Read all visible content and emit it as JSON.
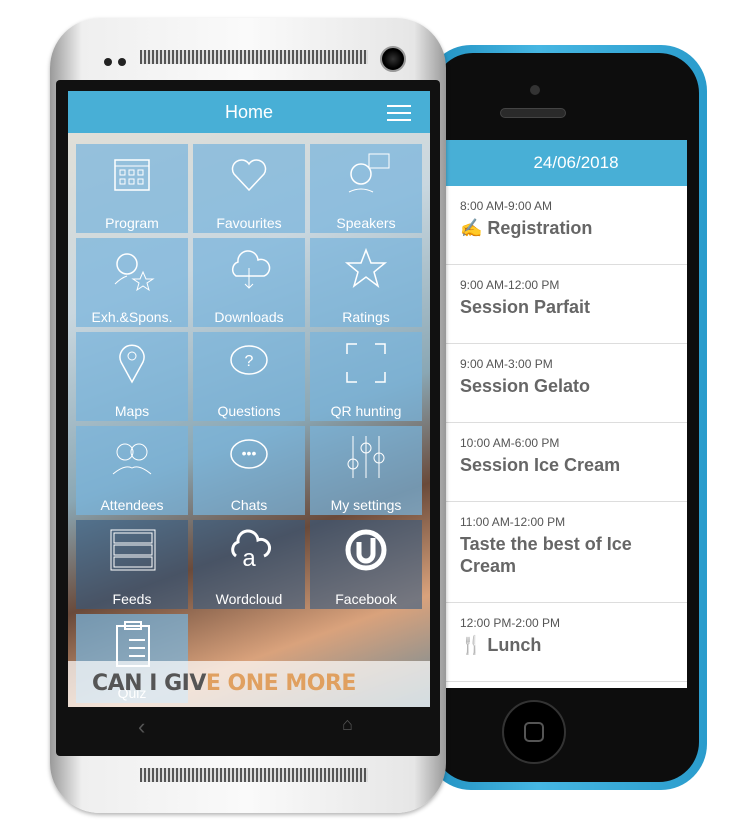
{
  "left_phone": {
    "header": {
      "title": "Home",
      "menu_icon": "hamburger-icon"
    },
    "tiles": [
      {
        "label": "Program",
        "icon": "calendar-icon"
      },
      {
        "label": "Favourites",
        "icon": "heart-icon"
      },
      {
        "label": "Speakers",
        "icon": "speaker-icon"
      },
      {
        "label": "Exh.&Spons.",
        "icon": "person-star-icon"
      },
      {
        "label": "Downloads",
        "icon": "cloud-download-icon"
      },
      {
        "label": "Ratings",
        "icon": "star-icon"
      },
      {
        "label": "Maps",
        "icon": "map-pin-icon"
      },
      {
        "label": "Questions",
        "icon": "question-bubble-icon"
      },
      {
        "label": "QR hunting",
        "icon": "qr-scan-icon"
      },
      {
        "label": "Attendees",
        "icon": "people-icon"
      },
      {
        "label": "Chats",
        "icon": "chat-icon"
      },
      {
        "label": "My settings",
        "icon": "sliders-icon"
      },
      {
        "label": "Feeds",
        "icon": "feed-icon"
      },
      {
        "label": "Wordcloud",
        "icon": "wordcloud-icon"
      },
      {
        "label": "Facebook",
        "icon": "facebook-icon"
      },
      {
        "label": "Quiz",
        "icon": "clipboard-icon"
      }
    ],
    "banner": {
      "part1": "CAN I GIV",
      "part2": "E ONE MORE SCOOP",
      "part3": "?!"
    }
  },
  "right_phone": {
    "date": "24/06/2018",
    "sessions": [
      {
        "time": "8:00 AM-9:00 AM",
        "title": "✍ Registration"
      },
      {
        "time": "9:00 AM-12:00 PM",
        "title": "Session Parfait"
      },
      {
        "time": "9:00 AM-3:00 PM",
        "title": "Session Gelato"
      },
      {
        "time": "10:00 AM-6:00 PM",
        "title": "Session Ice Cream"
      },
      {
        "time": "11:00 AM-12:00 PM",
        "title": "Taste the best of Ice Cream"
      },
      {
        "time": "12:00 PM-2:00 PM",
        "title": "🍴 Lunch"
      }
    ]
  },
  "colors": {
    "accent": "#48afd6",
    "tile": "#78b4dc"
  }
}
